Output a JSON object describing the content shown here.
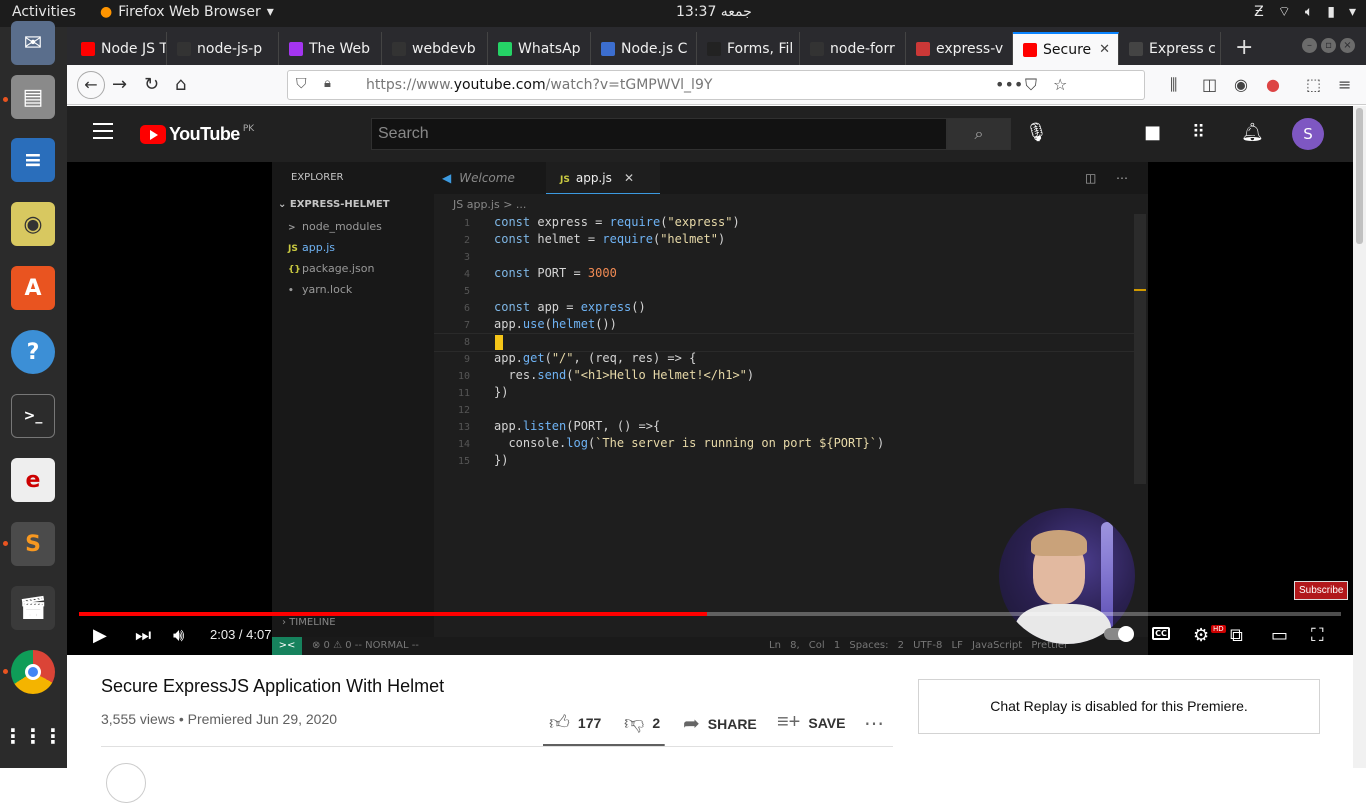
{
  "os": {
    "activities": "Activities",
    "app_name": "Firefox Web Browser",
    "clock": "13:37 جمعه"
  },
  "browser": {
    "tabs": [
      {
        "title": "Node JS T",
        "icon": "youtube-icon",
        "color": "#ff0000"
      },
      {
        "title": "node-js-p",
        "icon": "github-icon",
        "color": "#333333"
      },
      {
        "title": "The Web",
        "icon": "udemy-icon",
        "color": "#a435f0"
      },
      {
        "title": "webdevb",
        "icon": "github-icon",
        "color": "#333333"
      },
      {
        "title": "WhatsAp",
        "icon": "whatsapp-icon",
        "color": "#25d366"
      },
      {
        "title": "Node.js C",
        "icon": "devdocs-icon",
        "color": "#3c6ecf"
      },
      {
        "title": "Forms, Fil",
        "icon": "dev-icon",
        "color": "#222222"
      },
      {
        "title": "node-forr",
        "icon": "github-icon",
        "color": "#333333"
      },
      {
        "title": "express-v",
        "icon": "npm-icon",
        "color": "#cb3837"
      },
      {
        "title": "Secure",
        "icon": "youtube-icon",
        "color": "#ff0000",
        "active": true
      },
      {
        "title": "Express c",
        "icon": "express-icon",
        "color": "#444444"
      }
    ],
    "url_prefix": "https://www.",
    "url_domain": "youtube.com",
    "url_rest": "/watch?v=tGMPWVl_l9Y"
  },
  "youtube": {
    "logo": "YouTube",
    "region": "PK",
    "search_placeholder": "Search",
    "avatar_letter": "S"
  },
  "video": {
    "editor": {
      "explorer_label": "EXPLORER",
      "project": "EXPRESS-HELMET",
      "files": [
        {
          "name": "node_modules",
          "icon": ">",
          "color": "#999999"
        },
        {
          "name": "app.js",
          "icon": "JS",
          "color": "#cbcb41"
        },
        {
          "name": "package.json",
          "icon": "{}",
          "color": "#cbcb41"
        },
        {
          "name": "yarn.lock",
          "icon": "•",
          "color": "#999999"
        }
      ],
      "tabs": {
        "welcome": "Welcome",
        "active": "app.js"
      },
      "breadcrumb": "JS app.js > ...",
      "code": [
        "const express = require(\"express\")",
        "const helmet = require(\"helmet\")",
        "",
        "const PORT = 3000",
        "",
        "const app = express()",
        "app.use(helmet())",
        "",
        "app.get(\"/\", (req, res) => {",
        "  res.send(\"<h1>Hello Helmet!</h1>\")",
        "})",
        "",
        "app.listen(PORT, () =>{",
        "  console.log(`The server is running on port ${PORT}`)",
        "})"
      ],
      "timeline": "TIMELINE",
      "status_left": "⊗ 0 ⚠ 0   -- NORMAL --",
      "status_right": "Ln 8, Col 1  Spaces: 2  UTF-8  LF  JavaScript  Prettier"
    },
    "subscribe": "Subscribe",
    "time": "2:03 / 4:07",
    "progress_fraction": 0.498,
    "cc_label": "CC",
    "hd_label": "HD"
  },
  "details": {
    "title": "Secure ExpressJS Application With Helmet",
    "meta": "3,555 views • Premiered Jun 29, 2020",
    "likes": "177",
    "dislikes": "2",
    "share": "SHARE",
    "save": "SAVE",
    "like_fraction": 0.9888,
    "chat_replay": "Chat Replay is disabled for this Premiere."
  }
}
